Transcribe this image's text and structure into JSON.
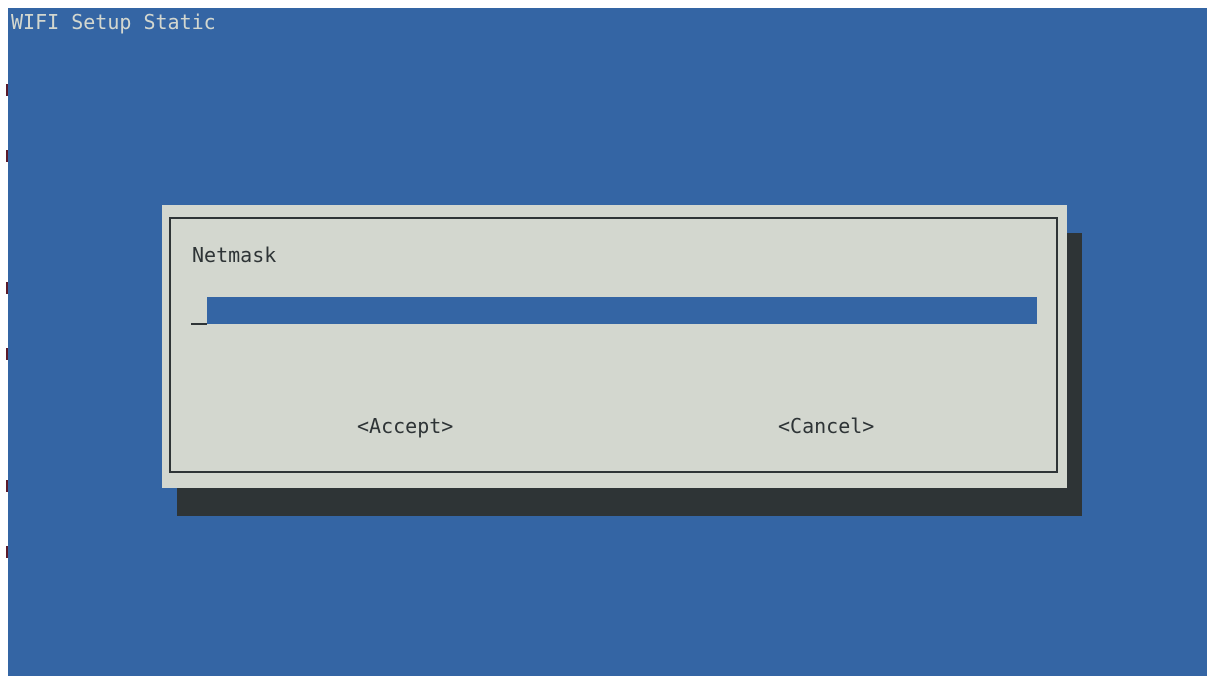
{
  "window": {
    "title": "WIFI Setup Static"
  },
  "dialog": {
    "prompt": "Netmask",
    "input": {
      "value": ""
    },
    "buttons": {
      "accept": "<Accept>",
      "cancel": "<Cancel>"
    }
  },
  "colors": {
    "background": "#3465a4",
    "dialog": "#d3d7cf",
    "shadow": "#2e3436",
    "text": "#2e3436",
    "input": "#3465a4"
  }
}
